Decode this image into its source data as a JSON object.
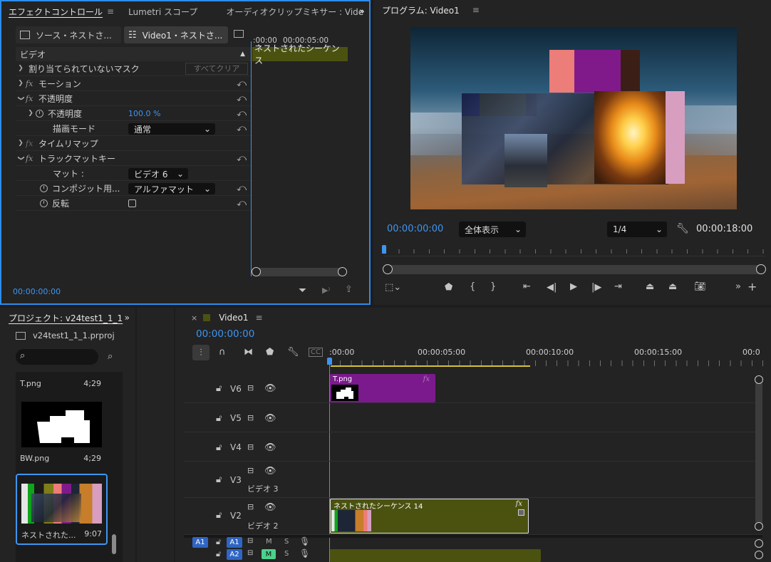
{
  "effect_controls": {
    "tabs": [
      "エフェクトコントロール",
      "Lumetri スコープ",
      "オーディオクリップミキサー : Vide"
    ],
    "source_tab": "ソース・ネストさ...",
    "seq_tab": "Video1・ネストさ...",
    "ruler": {
      "t0": ":00:00",
      "t1": "00:00:05:00"
    },
    "clip_bar": "ネストされたシーケンス",
    "section": "ビデオ",
    "mask_row": "割り当てられていないマスク",
    "clear_all": "すべてクリア",
    "motion": "モーション",
    "opacity": "不透明度",
    "opacity_param": "不透明度",
    "opacity_value": "100.0 %",
    "blend_mode_label": "描画モード",
    "blend_mode_value": "通常",
    "time_remap": "タイムリマップ",
    "track_matte": "トラックマットキー",
    "matte_label": "マット :",
    "matte_value": "ビデオ 6",
    "composite_label": "コンポジット用...",
    "composite_value": "アルファマット",
    "invert_label": "反転",
    "timecode": "00:00:00:00"
  },
  "program": {
    "tab": "プログラム: Video1",
    "timecode": "00:00:00:00",
    "fit": "全体表示",
    "quality": "1/4",
    "duration": "00:00:18:00"
  },
  "project": {
    "tab": "プロジェクト: v24test1_1_1",
    "file": "v24test1_1_1.prproj",
    "items": [
      {
        "name": "T.png",
        "dur": "4;29"
      },
      {
        "name": "BW.png",
        "dur": "4;29"
      },
      {
        "name": "ネストされた...",
        "dur": "9:07"
      }
    ]
  },
  "timeline": {
    "tab": "Video1",
    "timecode": "00:00:00:00",
    "ruler": [
      ":00:00",
      "00:00:05:00",
      "00:00:10:00",
      "00:00:15:00",
      "00:0"
    ],
    "tracks": [
      "V6",
      "V5",
      "V4",
      "V3",
      "V2"
    ],
    "v3_name": "ビデオ 3",
    "v2_name": "ビデオ 2",
    "clip_t": "T.png",
    "clip_nested": "ネストされたシーケンス 14",
    "a1": "A1",
    "a2": "A2",
    "m": "M",
    "s": "S"
  },
  "colors": {
    "accent": "#2d8ceb",
    "purple_clip": "#7b1a8c",
    "olive_clip": "#4b5210",
    "timecode": "#3e95f0"
  }
}
